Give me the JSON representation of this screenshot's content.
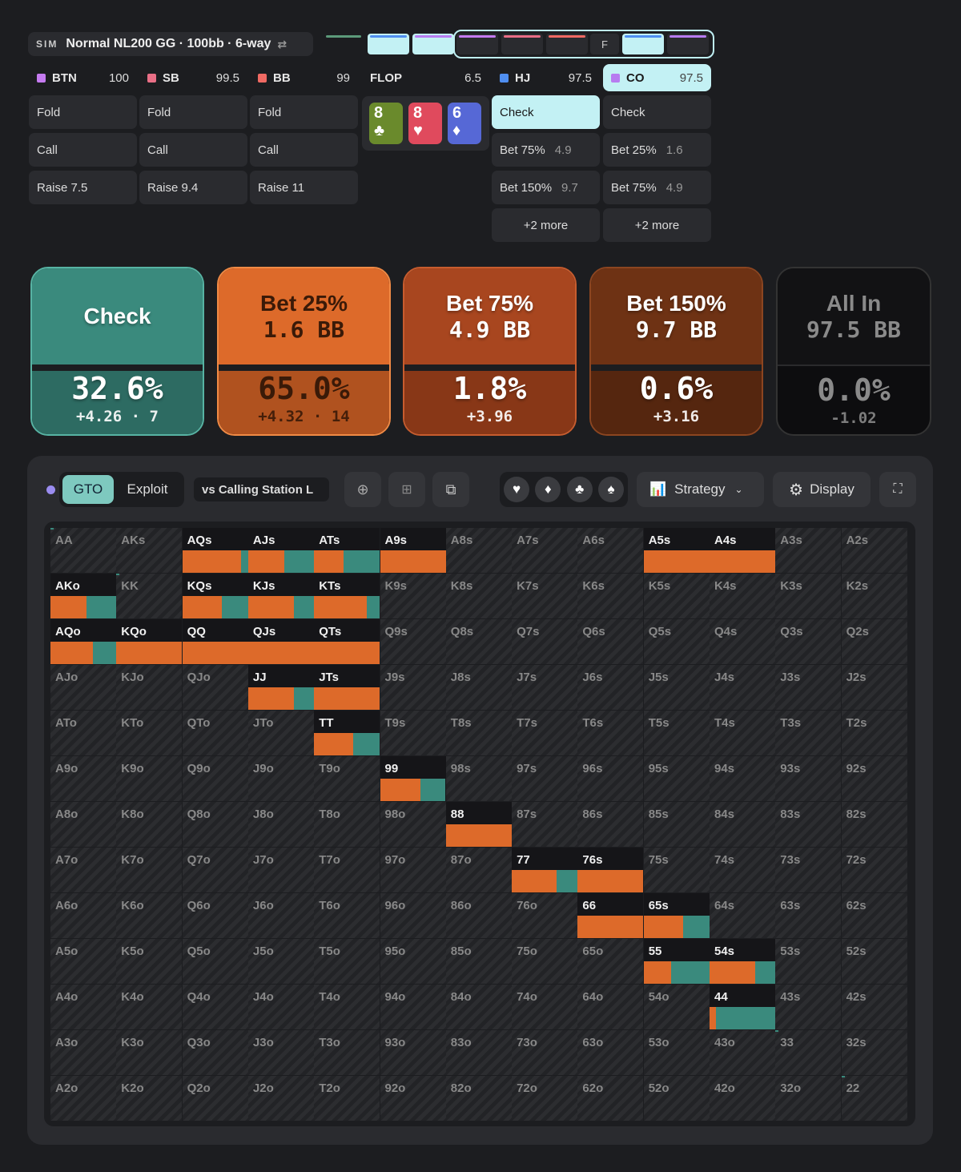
{
  "sim": {
    "tag": "SIM",
    "title": "Normal NL200 GG · 100bb · 6-way",
    "swap": "⇄"
  },
  "timeline": {
    "f_label": "F"
  },
  "columns": [
    {
      "pos": "BTN",
      "stack": "100",
      "color": "#c57bf0",
      "actions": [
        {
          "label": "Fold"
        },
        {
          "label": "Call"
        },
        {
          "label": "Raise 7.5"
        }
      ]
    },
    {
      "pos": "SB",
      "stack": "99.5",
      "color": "#e96f86",
      "actions": [
        {
          "label": "Fold"
        },
        {
          "label": "Call"
        },
        {
          "label": "Raise 9.4"
        }
      ]
    },
    {
      "pos": "BB",
      "stack": "99",
      "color": "#f06a63",
      "actions": [
        {
          "label": "Fold"
        },
        {
          "label": "Call"
        },
        {
          "label": "Raise 11"
        }
      ]
    },
    {
      "pos": "FLOP",
      "stack": "6.5",
      "color": "",
      "actions": []
    },
    {
      "pos": "HJ",
      "stack": "97.5",
      "color": "#4f8ef0",
      "actions": [
        {
          "label": "Check",
          "amt": ""
        },
        {
          "label": "Bet 75%",
          "amt": "4.9"
        },
        {
          "label": "Bet 150%",
          "amt": "9.7"
        },
        {
          "label": "+2 more",
          "amt": ""
        }
      ]
    },
    {
      "pos": "CO",
      "stack": "97.5",
      "color": "#b77cf0",
      "actions": [
        {
          "label": "Check",
          "amt": ""
        },
        {
          "label": "Bet 25%",
          "amt": "1.6"
        },
        {
          "label": "Bet 75%",
          "amt": "4.9"
        },
        {
          "label": "+2 more",
          "amt": ""
        }
      ]
    }
  ],
  "board": [
    {
      "rank": "8",
      "suit": "♣",
      "color": "#6a8a2c"
    },
    {
      "rank": "8",
      "suit": "♥",
      "color": "#e04a5d"
    },
    {
      "rank": "6",
      "suit": "♦",
      "color": "#5668d6"
    }
  ],
  "strategy": [
    {
      "name": "Check",
      "size": "",
      "pct": "32.6%",
      "ev": "+4.26",
      "combos": "7",
      "top": "#3a8a7d",
      "bottom": "#2d6b62",
      "border": "#57b3a3",
      "text": "#fff"
    },
    {
      "name": "Bet 25%",
      "size": "1.6 BB",
      "pct": "65.0%",
      "ev": "+4.32",
      "combos": "14",
      "top": "#dd6a2a",
      "bottom": "#b0521f",
      "border": "#f08a45",
      "text": "#3a1a08"
    },
    {
      "name": "Bet 75%",
      "size": "4.9 BB",
      "pct": "1.8%",
      "ev": "+3.96",
      "combos": "",
      "top": "#a8461f",
      "bottom": "#883717",
      "border": "#c75c2e",
      "text": "#fff"
    },
    {
      "name": "Bet 150%",
      "size": "9.7 BB",
      "pct": "0.6%",
      "ev": "+3.16",
      "combos": "",
      "top": "#6e3214",
      "bottom": "#55260f",
      "border": "#8c4520",
      "text": "#fff"
    },
    {
      "name": "All In",
      "size": "97.5 BB",
      "pct": "0.0%",
      "ev": "-1.02",
      "combos": "",
      "top": "#121214",
      "bottom": "#0d0d0f",
      "border": "#333",
      "text": "#8a8a8a"
    }
  ],
  "toolbar": {
    "gto": "GTO",
    "exploit": "Exploit",
    "vs": "vs Calling Station L",
    "strategy": "Strategy",
    "display": "Display",
    "suits": [
      "♥",
      "♦",
      "♣",
      "♠"
    ]
  },
  "ranks": [
    "A",
    "K",
    "Q",
    "J",
    "T",
    "9",
    "8",
    "7",
    "6",
    "5",
    "4",
    "3",
    "2"
  ],
  "grid_freq": {
    "AA": [
      0,
      0.05
    ],
    "AQs": [
      0.9,
      0.1
    ],
    "AJs": [
      0.55,
      0.45
    ],
    "ATs": [
      0.45,
      0.55
    ],
    "A9s": [
      1,
      0
    ],
    "A5s": [
      1,
      0
    ],
    "A4s": [
      1,
      0
    ],
    "AKo": [
      0.55,
      0.45
    ],
    "KK": [
      0,
      0.05
    ],
    "KQs": [
      0.6,
      0.4
    ],
    "KJs": [
      0.7,
      0.3
    ],
    "KTs": [
      0.8,
      0.2
    ],
    "AQo": [
      0.65,
      0.35
    ],
    "KQo": [
      1,
      0
    ],
    "QQ": [
      1,
      0
    ],
    "QJs": [
      1,
      0
    ],
    "QTs": [
      1,
      0
    ],
    "JJ": [
      0.7,
      0.3
    ],
    "JTs": [
      1,
      0
    ],
    "TT": [
      0.6,
      0.4
    ],
    "99": [
      0.62,
      0.38
    ],
    "88": [
      1,
      0
    ],
    "77": [
      0.68,
      0.32
    ],
    "76s": [
      1,
      0
    ],
    "66": [
      1,
      0
    ],
    "65s": [
      0.6,
      0.4
    ],
    "55": [
      0.42,
      0.58
    ],
    "54s": [
      0.7,
      0.3
    ],
    "44": [
      0.1,
      0.9
    ],
    "33": [
      0,
      0.05
    ],
    "22": [
      0,
      0.05
    ]
  }
}
